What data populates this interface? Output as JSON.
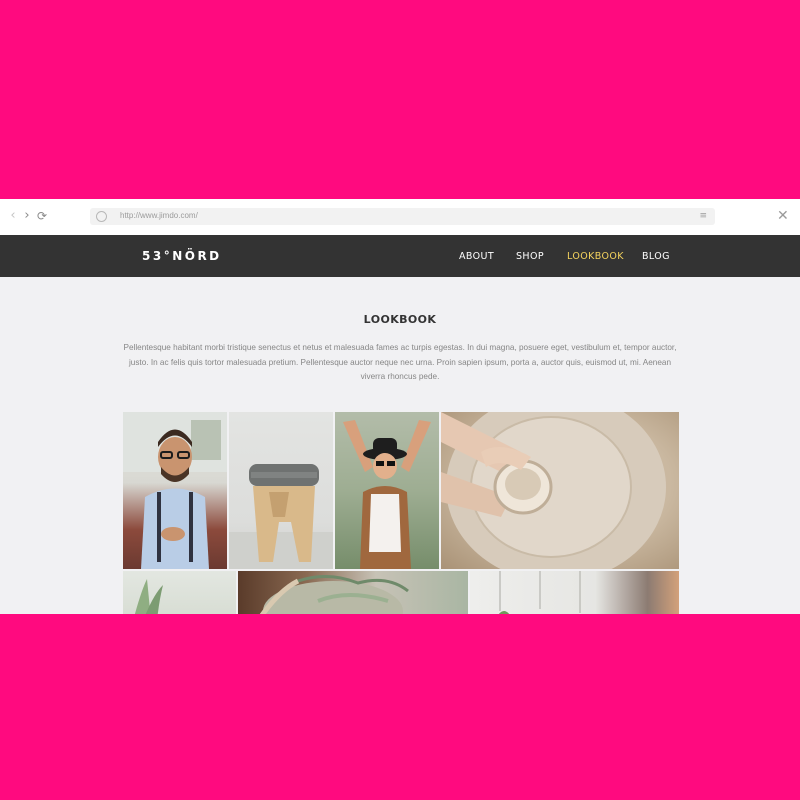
{
  "browser": {
    "url": "http://www.jimdo.com/",
    "back_icon": "‹",
    "forward_icon": "›",
    "reload_icon": "⟳",
    "menu_icon": "≡",
    "close_icon": "✕"
  },
  "site": {
    "logo": "53°NÖRD",
    "nav": [
      {
        "label": "ABOUT",
        "active": false
      },
      {
        "label": "SHOP",
        "active": false
      },
      {
        "label": "LOOKBOOK",
        "active": true
      },
      {
        "label": "BLOG",
        "active": false
      }
    ]
  },
  "page": {
    "title": "LOOKBOOK",
    "intro": "Pellentesque habitant morbi tristique senectus et netus et malesuada fames ac turpis egestas. In dui magna, posuere eget, vestibulum et, tempor auctor, justo. In ac felis quis tortor malesuada pretium. Pellentesque auctor neque nec urna. Proin sapien ipsum, porta a, auctor quis, euismod ut, mi. Aenean viverra rhoncus pede."
  },
  "gallery": [
    {
      "subject": "man-with-phone-photo"
    },
    {
      "subject": "wooden-stool-photo"
    },
    {
      "subject": "woman-with-hat-photo"
    },
    {
      "subject": "pottery-wheel-photo"
    },
    {
      "subject": "plant-photo"
    },
    {
      "subject": "succulent-basket-photo"
    },
    {
      "subject": "hanging-plants-photo"
    }
  ],
  "colors": {
    "background": "#ff0a7f",
    "header": "#333333",
    "active_nav": "#f4d35e",
    "page_bg": "#f1f1f3"
  }
}
